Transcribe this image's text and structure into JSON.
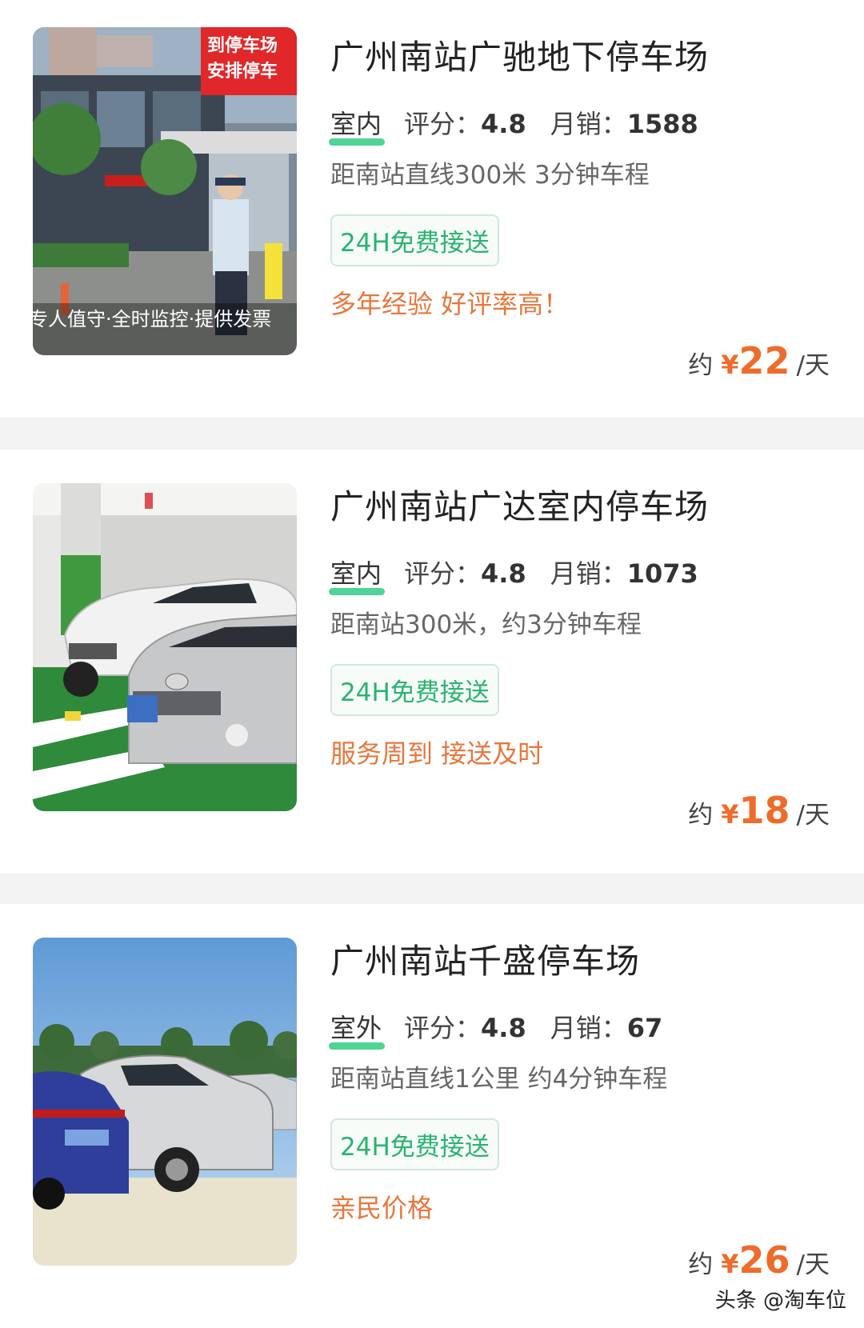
{
  "listings": [
    {
      "name": "广州南站广驰地下停车场",
      "type": "室内",
      "rating_label": "评分：",
      "rating": "4.8",
      "sales_label": "月销：",
      "sales": "1588",
      "distance": "距南站直线300米 3分钟车程",
      "badge": "24H免费接送",
      "slogan": "多年经验 好评率高！",
      "price_prefix": "约",
      "currency": "¥",
      "price": "22",
      "price_unit": "/天",
      "photo_caption": "专人值守·全时监控·提供发票",
      "photo_sign_1": "到停车场",
      "photo_sign_2": "安排停车"
    },
    {
      "name": "广州南站广达室内停车场",
      "type": "室内",
      "rating_label": "评分：",
      "rating": "4.8",
      "sales_label": "月销：",
      "sales": "1073",
      "distance": "距南站300米，约3分钟车程",
      "badge": "24H免费接送",
      "slogan": "服务周到 接送及时",
      "price_prefix": "约",
      "currency": "¥",
      "price": "18",
      "price_unit": "/天"
    },
    {
      "name": "广州南站千盛停车场",
      "type": "室外",
      "rating_label": "评分：",
      "rating": "4.8",
      "sales_label": "月销：",
      "sales": "67",
      "distance": "距南站直线1公里 约4分钟车程",
      "badge": "24H免费接送",
      "slogan": "亲民价格",
      "price_prefix": "约",
      "currency": "¥",
      "price": "26",
      "price_unit": "/天"
    }
  ],
  "watermark": "头条 @淘车位",
  "colors": {
    "accent_orange": "#ee6c2b",
    "badge_green": "#29b36f",
    "tag_underline": "#3ccf8a",
    "divider": "#f3f3f3"
  }
}
